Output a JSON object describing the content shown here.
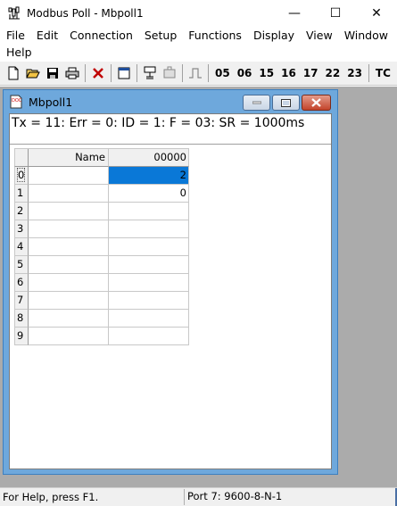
{
  "app": {
    "title": "Modbus Poll - Mbpoll1",
    "icon": "modbus-poll-app-icon"
  },
  "window_controls": {
    "minimize": "—",
    "maximize": "☐",
    "close": "✕"
  },
  "menu": [
    "File",
    "Edit",
    "Connection",
    "Setup",
    "Functions",
    "Display",
    "View",
    "Window",
    "Help"
  ],
  "toolbar": {
    "icons": [
      "new-icon",
      "open-icon",
      "save-icon",
      "print-icon",
      "delete-icon",
      "window-icon",
      "connect-icon",
      "disconnect-icon",
      "pulse-icon"
    ],
    "function_codes": [
      "05",
      "06",
      "15",
      "16",
      "17",
      "22",
      "23",
      "TC"
    ]
  },
  "child": {
    "title": "Mbpoll1",
    "status_line": "Tx = 11: Err = 0: ID = 1: F = 03: SR = 1000ms"
  },
  "grid": {
    "headers": [
      "",
      "Name",
      "00000"
    ],
    "rows": [
      {
        "index": "0",
        "name": "",
        "value": "2"
      },
      {
        "index": "1",
        "name": "",
        "value": "0"
      },
      {
        "index": "2",
        "name": "",
        "value": ""
      },
      {
        "index": "3",
        "name": "",
        "value": ""
      },
      {
        "index": "4",
        "name": "",
        "value": ""
      },
      {
        "index": "5",
        "name": "",
        "value": ""
      },
      {
        "index": "6",
        "name": "",
        "value": ""
      },
      {
        "index": "7",
        "name": "",
        "value": ""
      },
      {
        "index": "8",
        "name": "",
        "value": ""
      },
      {
        "index": "9",
        "name": "",
        "value": ""
      }
    ]
  },
  "statusbar": {
    "help": "For Help, press F1.",
    "port": "Port 7: 9600-8-N-1"
  },
  "colors": {
    "selection": "#0a78d7",
    "child_frame": "#6ea8dc",
    "mdi_background": "#ababab"
  }
}
